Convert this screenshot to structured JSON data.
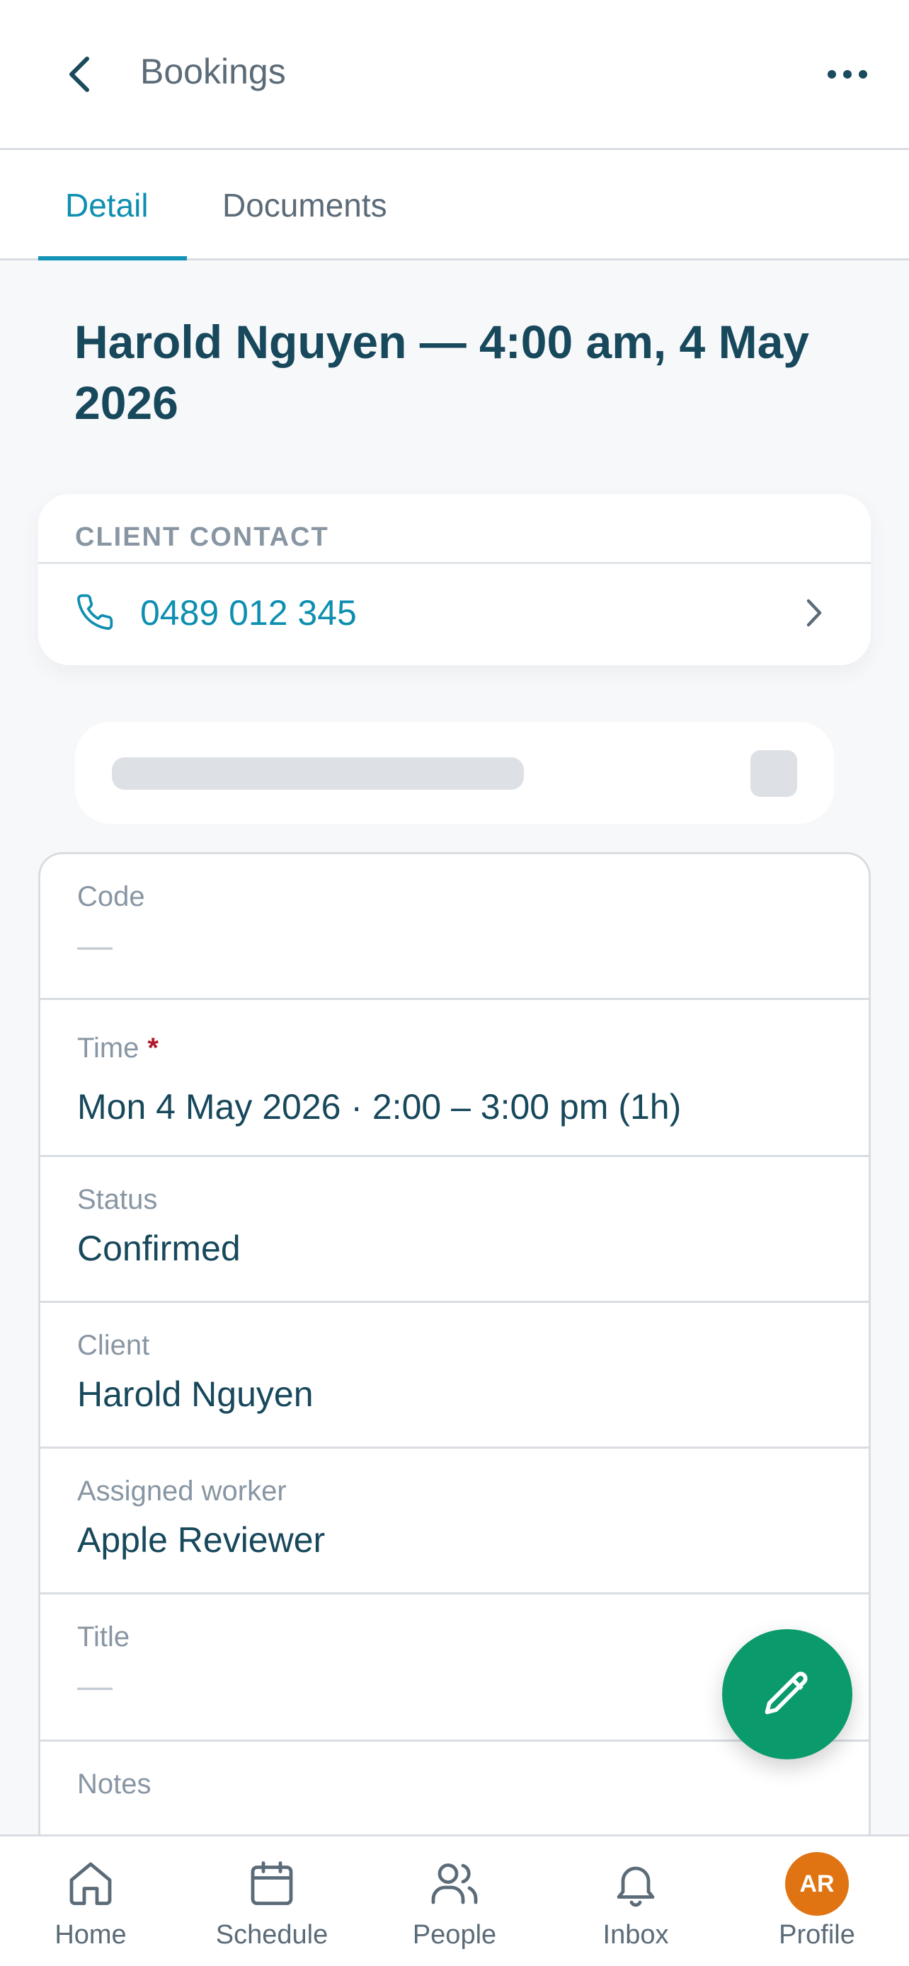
{
  "header": {
    "title": "Bookings",
    "back_icon": "chevron-left-icon",
    "more_icon": "more-horizontal-icon"
  },
  "tabs": [
    {
      "label": "Detail",
      "active": true
    },
    {
      "label": "Documents",
      "active": false
    }
  ],
  "booking": {
    "title": "Harold Nguyen — 4:00 am, 4 May 2026"
  },
  "contact": {
    "section_label": "CLIENT CONTACT",
    "phone": "0489 012 345",
    "phone_icon": "phone-icon"
  },
  "fields": {
    "code": {
      "label": "Code",
      "value": "—"
    },
    "time": {
      "label": "Time",
      "required_mark": "*",
      "value": "Mon 4 May 2026 · 2:00 – 3:00 pm (1h)"
    },
    "status": {
      "label": "Status",
      "value": "Confirmed"
    },
    "client": {
      "label": "Client",
      "value": "Harold Nguyen"
    },
    "worker": {
      "label": "Assigned worker",
      "value": "Apple Reviewer"
    },
    "title": {
      "label": "Title",
      "value": "—"
    },
    "notes": {
      "label": "Notes"
    }
  },
  "fab": {
    "icon": "pencil-icon"
  },
  "nav": [
    {
      "label": "Home",
      "icon": "home-icon"
    },
    {
      "label": "Schedule",
      "icon": "calendar-icon"
    },
    {
      "label": "People",
      "icon": "people-icon"
    },
    {
      "label": "Inbox",
      "icon": "bell-icon"
    },
    {
      "label": "Profile",
      "avatar": "AR"
    }
  ],
  "colors": {
    "accent": "#1393b5",
    "fab": "#0a9a6c",
    "avatar": "#e07412",
    "required": "#b3192d"
  }
}
